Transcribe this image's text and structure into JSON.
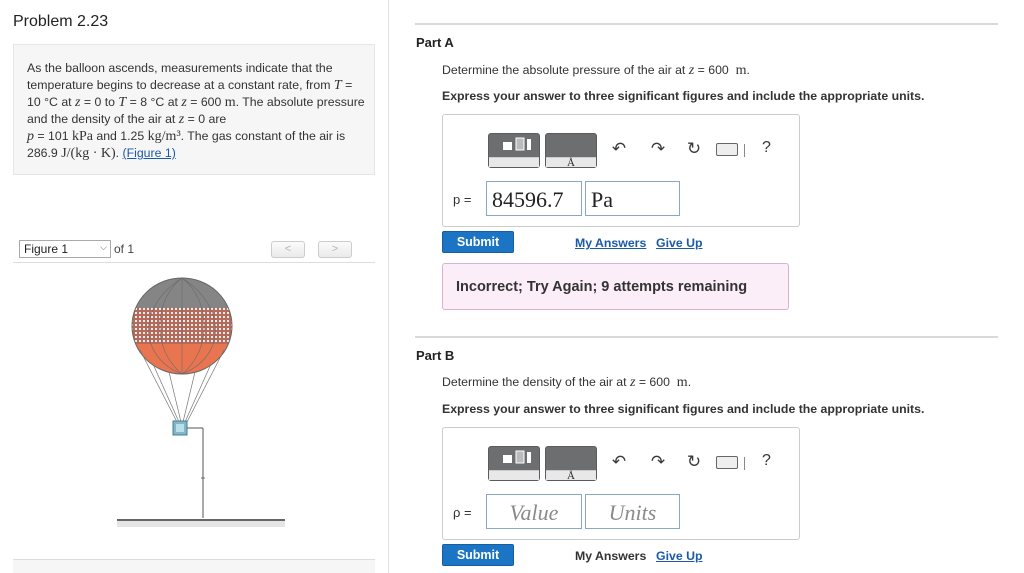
{
  "problem": {
    "title": "Problem 2.23",
    "text_parts": {
      "p1": "As the balloon ascends, measurements indicate that the temperature begins to decrease at a constant rate, from ",
      "T_sym": "T",
      "T1": " = 10 °C",
      "at1": " at ",
      "z_sym": "z",
      "z1": " = 0 to ",
      "T2": " = 8 °C",
      "at2": " at ",
      "z2": " = 600",
      "m_unit": "m",
      "p2": ". The absolute pressure and the density of the air at ",
      "z3": " = 0 are ",
      "p_sym": "p",
      "p_val": " = 101",
      "kPa": "kPa",
      "and": " and 1.25",
      "rho_unit": "kg/m³",
      "p3": ". The gas constant of the air is 286.9",
      "R_unit": "J/(kg · K)",
      "p4": ". ",
      "fig_link": "(Figure 1)"
    }
  },
  "figure_nav": {
    "selected": "Figure 1",
    "of_label": "of 1",
    "prev": "<",
    "next": ">"
  },
  "part_a": {
    "title": "Part A",
    "question_prefix": "Determine the absolute pressure of the air at ",
    "z_sym": "z",
    "question_eq": " = 600",
    "unit": "m",
    "question_suffix": ".",
    "instructions": "Express your answer to three significant figures and include the appropriate units.",
    "var_label": "p =",
    "value": "84596.7",
    "units": "Pa",
    "submit": "Submit",
    "my_answers": "My Answers",
    "give_up": "Give Up",
    "feedback": "Incorrect; Try Again; 9 attempts remaining"
  },
  "part_b": {
    "title": "Part B",
    "question_prefix": "Determine the density of the air at ",
    "z_sym": "z",
    "question_eq": " = 600",
    "unit": "m",
    "question_suffix": ".",
    "instructions": "Express your answer to three significant figures and include the appropriate units.",
    "var_label": "ρ =",
    "value_placeholder": "Value",
    "units_placeholder": "Units",
    "submit": "Submit",
    "my_answers": "My Answers",
    "give_up": "Give Up"
  },
  "toolbar": {
    "undo": "↶",
    "redo": "↷",
    "reset": "↻",
    "help": "?",
    "units_glyph": "Å"
  },
  "colors": {
    "accent": "#1c74c4",
    "feedback_bg": "#fbeef8",
    "balloon_top": "#8a8a8a",
    "balloon_band": "#c05a42",
    "balloon_bottom": "#e87452"
  }
}
